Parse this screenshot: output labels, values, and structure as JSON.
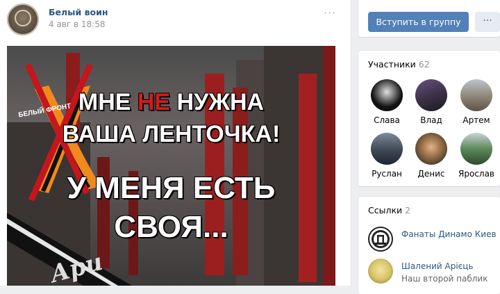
{
  "post": {
    "author": "Белый воин",
    "date": "4 авг в 18:58",
    "more_icon": "ellipsis-icon",
    "image": {
      "logo_text": "БЕЛЫЙ ФРОНТ",
      "line1_a": "МНЕ ",
      "line1_b": "НЕ",
      "line1_c": " НУЖНА",
      "line2": "ВАША ЛЕНТОЧКА!",
      "line3": "У МЕНЯ ЕСТЬ",
      "line4": "СВОЯ...",
      "corner_text": "Ари"
    }
  },
  "group": {
    "join_label": "Вступить в группу",
    "more_label": "···"
  },
  "members": {
    "title": "Участники",
    "count": "62",
    "items": [
      {
        "name": "Слава"
      },
      {
        "name": "Влад"
      },
      {
        "name": "Артем"
      },
      {
        "name": "Руслан"
      },
      {
        "name": "Денис"
      },
      {
        "name": "Ярослав"
      }
    ]
  },
  "links": {
    "title": "Ссылки",
    "count": "2",
    "items": [
      {
        "name": "Фанаты Динамо Киев",
        "desc": ""
      },
      {
        "name": "Шалений Арієць",
        "desc": "Наш второй паблик"
      }
    ]
  },
  "colors": {
    "link": "#2a5885",
    "button": "#5181b8",
    "accent_red": "#d21b1b"
  }
}
